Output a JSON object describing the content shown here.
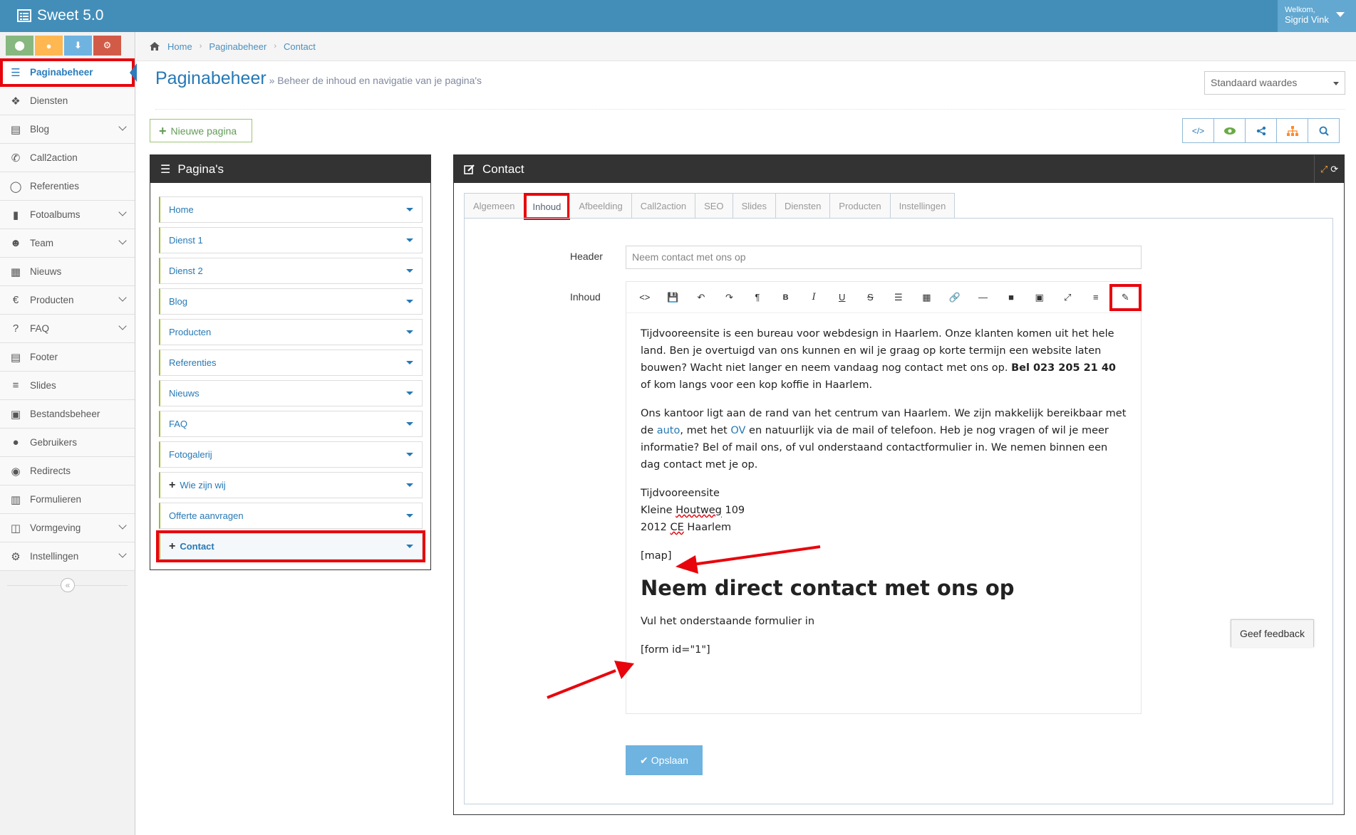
{
  "app": {
    "brand": "Sweet 5.0"
  },
  "user": {
    "welcome": "Welkom,",
    "name": "Sigrid Vink"
  },
  "colors": {
    "topbar": "#438eb9",
    "accent": "#2679b5",
    "highlight": "#e8040c",
    "shortcut_green": "#87b87f",
    "shortcut_orange": "#ffb752",
    "shortcut_blue": "#6fb3e0",
    "shortcut_red": "#d15b47"
  },
  "shortcuts": [
    {
      "icon": "map-marker-icon"
    },
    {
      "icon": "user-icon"
    },
    {
      "icon": "download-icon"
    },
    {
      "icon": "cogs-icon"
    }
  ],
  "sidebar": {
    "items": [
      {
        "label": "Paginabeheer",
        "icon": "bars-icon",
        "active": true
      },
      {
        "label": "Diensten",
        "icon": "cubes-icon"
      },
      {
        "label": "Blog",
        "icon": "file-icon",
        "submenu": true
      },
      {
        "label": "Call2action",
        "icon": "phone-icon"
      },
      {
        "label": "Referenties",
        "icon": "comment-icon"
      },
      {
        "label": "Fotoalbums",
        "icon": "book-icon",
        "submenu": true
      },
      {
        "label": "Team",
        "icon": "users-icon",
        "submenu": true
      },
      {
        "label": "Nieuws",
        "icon": "newspaper-icon"
      },
      {
        "label": "Producten",
        "icon": "euro-icon",
        "submenu": true
      },
      {
        "label": "FAQ",
        "icon": "question-icon",
        "submenu": true
      },
      {
        "label": "Footer",
        "icon": "list-alt-icon"
      },
      {
        "label": "Slides",
        "icon": "sliders-icon"
      },
      {
        "label": "Bestandsbeheer",
        "icon": "image-icon"
      },
      {
        "label": "Gebruikers",
        "icon": "user-icon"
      },
      {
        "label": "Redirects",
        "icon": "arrow-circle-icon"
      },
      {
        "label": "Formulieren",
        "icon": "form-icon"
      },
      {
        "label": "Vormgeving",
        "icon": "columns-icon",
        "submenu": true
      },
      {
        "label": "Instellingen",
        "icon": "gear-icon",
        "submenu": true
      }
    ]
  },
  "breadcrumbs": [
    "Home",
    "Paginabeheer",
    "Contact"
  ],
  "header": {
    "title": "Paginabeheer",
    "subtitle": "» Beheer de inhoud en navigatie van je pagina's",
    "select_value": "Standaard waardes",
    "new_page": "Nieuwe pagina"
  },
  "toolbar_right": [
    {
      "icon": "code-icon",
      "color": "#2679b5"
    },
    {
      "icon": "eye-icon",
      "color": "#69aa46"
    },
    {
      "icon": "share-icon",
      "color": "#2679b5"
    },
    {
      "icon": "sitemap-icon",
      "color": "#ff892a"
    },
    {
      "icon": "search-icon",
      "color": "#2679b5"
    }
  ],
  "pages_panel": {
    "title": "Pagina's",
    "items": [
      {
        "label": "Home"
      },
      {
        "label": "Dienst 1"
      },
      {
        "label": "Dienst 2"
      },
      {
        "label": "Blog"
      },
      {
        "label": "Producten"
      },
      {
        "label": "Referenties"
      },
      {
        "label": "Nieuws"
      },
      {
        "label": "FAQ"
      },
      {
        "label": "Fotogalerij"
      },
      {
        "label": "Wie zijn wij",
        "plus": true
      },
      {
        "label": "Offerte aanvragen"
      },
      {
        "label": "Contact",
        "plus": true,
        "selected": true
      }
    ]
  },
  "editor": {
    "title": "Contact",
    "tabs": [
      {
        "label": "Algemeen"
      },
      {
        "label": "Inhoud",
        "active": true
      },
      {
        "label": "Afbeelding"
      },
      {
        "label": "Call2action"
      },
      {
        "label": "SEO"
      },
      {
        "label": "Slides"
      },
      {
        "label": "Diensten"
      },
      {
        "label": "Producten"
      },
      {
        "label": "Instellingen"
      }
    ],
    "header_label": "Header",
    "header_placeholder": "Neem contact met ons op",
    "content_label": "Inhoud",
    "wysiwyg_tools": [
      "code-view-icon",
      "save-icon",
      "undo-icon",
      "redo-icon",
      "paragraph-icon",
      "bold-icon",
      "italic-icon",
      "underline-icon",
      "strikethrough-icon",
      "list-icon",
      "table-icon",
      "link-icon",
      "horizontal-rule-icon",
      "video-icon",
      "image-icon",
      "fullscreen-icon",
      "align-icon",
      "plugin-icon"
    ],
    "content": {
      "p1_a": "Tijdvooreensite is een bureau voor webdesign in Haarlem. Onze klanten komen uit het hele land. Ben je overtuigd van ons kunnen en wil je graag op korte termijn een website laten bouwen? Wacht niet langer en neem vandaag nog contact met ons op. ",
      "p1_bold": "Bel 023 205 21 40",
      "p1_b": " of kom langs voor een kop koffie in Haarlem.",
      "p2_a": "Ons kantoor ligt aan de rand van het centrum van Haarlem. We zijn makkelijk bereikbaar met de ",
      "p2_link1": "auto",
      "p2_b": ", met het ",
      "p2_link2": "OV",
      "p2_c": " en natuurlijk via de mail of telefoon. Heb je nog vragen of wil je meer informatie? Bel of mail ons, of vul onderstaand contactformulier in. We nemen binnen een dag contact met je op.",
      "addr1": "Tijdvooreensite",
      "addr2_a": "Kleine ",
      "addr2_sq": "Houtweg",
      "addr2_b": " 109",
      "addr3_a": "2012 ",
      "addr3_sq": "CE",
      "addr3_b": " Haarlem",
      "map": "[map]",
      "heading": "Neem direct contact met ons op",
      "sub": "Vul het onderstaande formulier in",
      "form": "[form id=\"1\"]"
    },
    "save": "Opslaan"
  },
  "feedback": "Geef feedback"
}
